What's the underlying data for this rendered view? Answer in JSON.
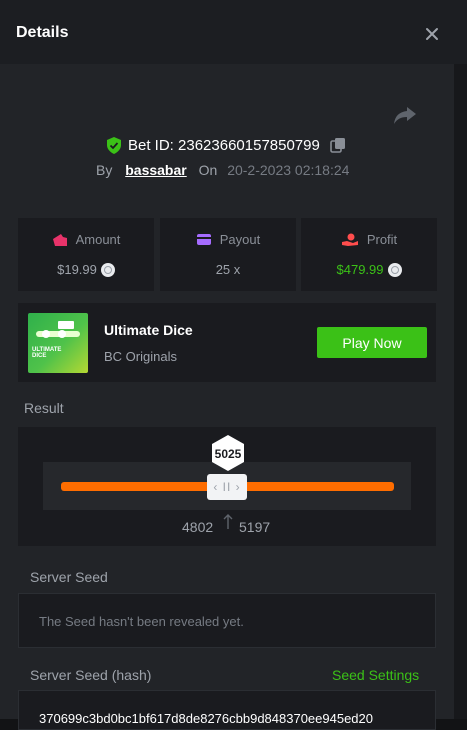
{
  "header": {
    "title": "Details"
  },
  "bet": {
    "id_text": "Bet ID: 23623660157850799",
    "by_label": "By",
    "username": "bassabar",
    "on_label": "On",
    "datetime": "20-2-2023 02:18:24"
  },
  "stats": [
    {
      "label": "Amount",
      "value": "$19.99",
      "icon": "wallet-icon",
      "color": "#e8336a"
    },
    {
      "label": "Payout",
      "value": "25 x",
      "icon": "card-icon",
      "color": "#a66cff"
    },
    {
      "label": "Profit",
      "value": "$479.99",
      "icon": "hand-coin-icon",
      "color": "#ff4d4d",
      "value_color": "#3bc117"
    }
  ],
  "game": {
    "name": "Ultimate Dice",
    "provider": "BC Originals",
    "thumb_text": "ULTIMATE\nDICE",
    "play_label": "Play Now"
  },
  "result": {
    "label": "Result",
    "value": "5025",
    "range_low": "4802",
    "range_high": "5197",
    "handle_glyph": "‹ II ›"
  },
  "server_seed": {
    "label": "Server Seed",
    "placeholder": "The Seed hasn't been revealed yet."
  },
  "server_seed_hash": {
    "label": "Server Seed (hash)",
    "settings_label": "Seed Settings",
    "value": "370699c3bd0bc1bf617d8de8276cbb9d848370ee945ed20"
  },
  "colors": {
    "accent_green": "#3bc117",
    "accent_orange": "#ff6d00",
    "panel": "#222428",
    "card": "#1a1b1f"
  }
}
